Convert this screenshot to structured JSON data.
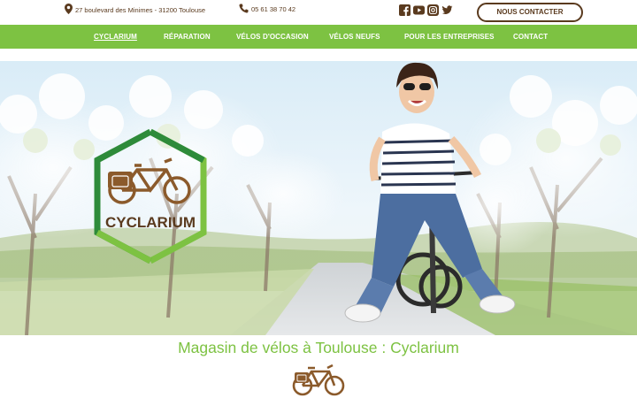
{
  "topbar": {
    "address": "27 boulevard des Minimes - 31200 Toulouse",
    "phone": "05 61 38 70 42",
    "social_icons": [
      "facebook-icon",
      "youtube-icon",
      "instagram-icon",
      "twitter-icon"
    ],
    "contact_label": "NOUS CONTACTER"
  },
  "nav": {
    "items": [
      {
        "label": "CYCLARIUM",
        "active": true
      },
      {
        "label": "RÉPARATION",
        "active": false
      },
      {
        "label": "VÉLOS D'OCCASION",
        "active": false
      },
      {
        "label": "VÉLOS NEUFS",
        "active": false
      },
      {
        "label": "POUR LES ENTREPRISES",
        "active": false
      },
      {
        "label": "CONTACT",
        "active": false
      }
    ]
  },
  "hero": {
    "logo_text": "CYCLARIUM"
  },
  "main": {
    "headline": "Magasin de vélos à Toulouse : Cyclarium"
  },
  "colors": {
    "brand_green": "#7dc242",
    "brand_brown": "#5a3a1e",
    "logo_dark_green": "#2e8b3a"
  }
}
